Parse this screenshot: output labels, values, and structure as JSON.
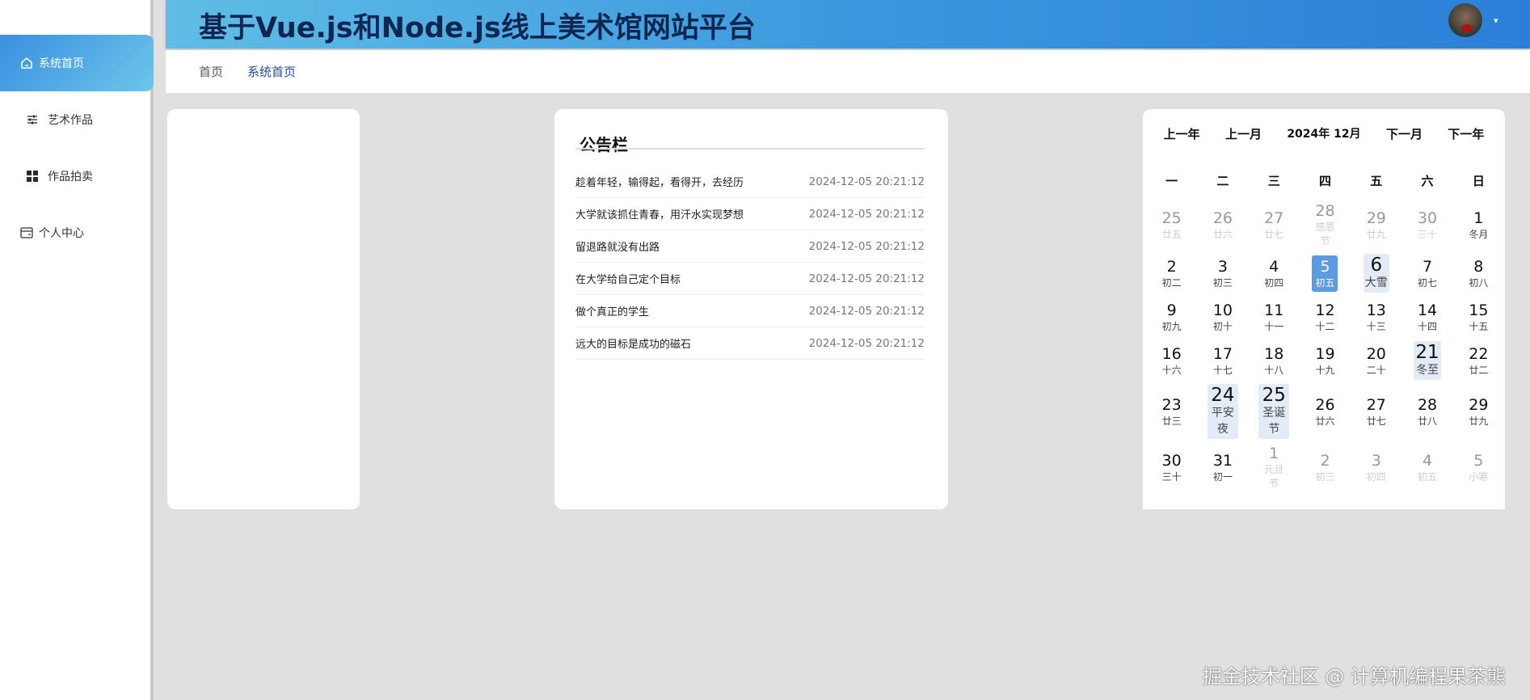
{
  "sidebar": {
    "items": [
      {
        "label": "系统首页",
        "icon": "home-icon"
      },
      {
        "label": "艺术作品",
        "icon": "sliders-icon"
      },
      {
        "label": "作品拍卖",
        "icon": "grid-icon"
      },
      {
        "label": "个人中心",
        "icon": "card-icon"
      }
    ]
  },
  "header": {
    "title": "基于Vue.js和Node.js线上美术馆网站平台",
    "avatar": "user-avatar",
    "caret": "▾"
  },
  "breadcrumb": [
    "首页",
    "系统首页"
  ],
  "notice": {
    "title": "公告栏",
    "items": [
      {
        "text": "趁着年轻，输得起，看得开，去经历",
        "date": "2024-12-05 20:21:12"
      },
      {
        "text": "大学就该抓住青春，用汗水实现梦想",
        "date": "2024-12-05 20:21:12"
      },
      {
        "text": "留退路就没有出路",
        "date": "2024-12-05 20:21:12"
      },
      {
        "text": "在大学给自己定个目标",
        "date": "2024-12-05 20:21:12"
      },
      {
        "text": "做个真正的学生",
        "date": "2024-12-05 20:21:12"
      },
      {
        "text": "远大的目标是成功的磁石",
        "date": "2024-12-05 20:21:12"
      }
    ]
  },
  "calendar": {
    "prev_year": "上一年",
    "prev_month": "上一月",
    "current": "2024年 12月",
    "next_month": "下一月",
    "next_year": "下一年",
    "weekdays": [
      "一",
      "二",
      "三",
      "四",
      "五",
      "六",
      "日"
    ],
    "days": [
      {
        "n": "25",
        "s": "廿五",
        "t": "other"
      },
      {
        "n": "26",
        "s": "廿六",
        "t": "other"
      },
      {
        "n": "27",
        "s": "廿七",
        "t": "other"
      },
      {
        "n": "28",
        "s": "感恩节",
        "t": "other"
      },
      {
        "n": "29",
        "s": "廿九",
        "t": "other"
      },
      {
        "n": "30",
        "s": "三十",
        "t": "other"
      },
      {
        "n": "1",
        "s": "冬月",
        "t": ""
      },
      {
        "n": "2",
        "s": "初二",
        "t": ""
      },
      {
        "n": "3",
        "s": "初三",
        "t": ""
      },
      {
        "n": "4",
        "s": "初四",
        "t": ""
      },
      {
        "n": "5",
        "s": "初五",
        "t": "today"
      },
      {
        "n": "6",
        "s": "大雪",
        "t": "fest"
      },
      {
        "n": "7",
        "s": "初七",
        "t": ""
      },
      {
        "n": "8",
        "s": "初八",
        "t": ""
      },
      {
        "n": "9",
        "s": "初九",
        "t": ""
      },
      {
        "n": "10",
        "s": "初十",
        "t": ""
      },
      {
        "n": "11",
        "s": "十一",
        "t": ""
      },
      {
        "n": "12",
        "s": "十二",
        "t": ""
      },
      {
        "n": "13",
        "s": "十三",
        "t": ""
      },
      {
        "n": "14",
        "s": "十四",
        "t": ""
      },
      {
        "n": "15",
        "s": "十五",
        "t": ""
      },
      {
        "n": "16",
        "s": "十六",
        "t": ""
      },
      {
        "n": "17",
        "s": "十七",
        "t": ""
      },
      {
        "n": "18",
        "s": "十八",
        "t": ""
      },
      {
        "n": "19",
        "s": "十九",
        "t": ""
      },
      {
        "n": "20",
        "s": "二十",
        "t": ""
      },
      {
        "n": "21",
        "s": "冬至",
        "t": "fest"
      },
      {
        "n": "22",
        "s": "廿二",
        "t": ""
      },
      {
        "n": "23",
        "s": "廿三",
        "t": ""
      },
      {
        "n": "24",
        "s": "平安夜",
        "t": "fest"
      },
      {
        "n": "25",
        "s": "圣诞节",
        "t": "fest"
      },
      {
        "n": "26",
        "s": "廿六",
        "t": ""
      },
      {
        "n": "27",
        "s": "廿七",
        "t": ""
      },
      {
        "n": "28",
        "s": "廿八",
        "t": ""
      },
      {
        "n": "29",
        "s": "廿九",
        "t": ""
      },
      {
        "n": "30",
        "s": "三十",
        "t": ""
      },
      {
        "n": "31",
        "s": "初一",
        "t": ""
      },
      {
        "n": "1",
        "s": "元旦节",
        "t": "other"
      },
      {
        "n": "2",
        "s": "初三",
        "t": "other"
      },
      {
        "n": "3",
        "s": "初四",
        "t": "other"
      },
      {
        "n": "4",
        "s": "初五",
        "t": "other"
      },
      {
        "n": "5",
        "s": "小寒",
        "t": "other"
      }
    ]
  },
  "watermark": "掘金技术社区 @ 计算机编程果茶熊"
}
